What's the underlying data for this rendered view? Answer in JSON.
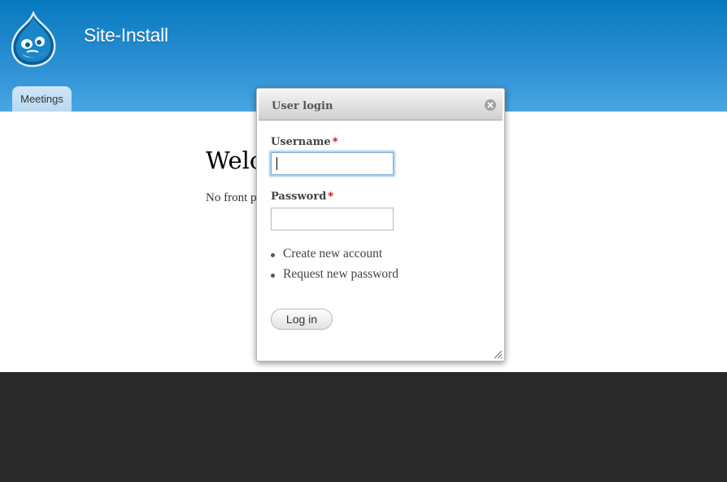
{
  "header": {
    "site_name": "Site-Install",
    "logo_icon": "drupal-drop-icon",
    "tabs": [
      {
        "label": "Meetings"
      }
    ]
  },
  "main": {
    "title": "Welc",
    "text": "No front p"
  },
  "dialog": {
    "title": "User login",
    "close_icon": "close-icon",
    "username_label": "Username",
    "password_label": "Password",
    "required_mark": "*",
    "username_value": "",
    "password_value": "",
    "links": [
      {
        "label": "Create new account"
      },
      {
        "label": "Request new password"
      }
    ],
    "submit_label": "Log in"
  },
  "colors": {
    "header_top": "#0779bf",
    "header_bottom": "#48a6e2",
    "tab_bg": "#cfe6f7",
    "footer_bg": "#292929",
    "required": "#cc0000",
    "focus_ring": "#a6cbec"
  }
}
